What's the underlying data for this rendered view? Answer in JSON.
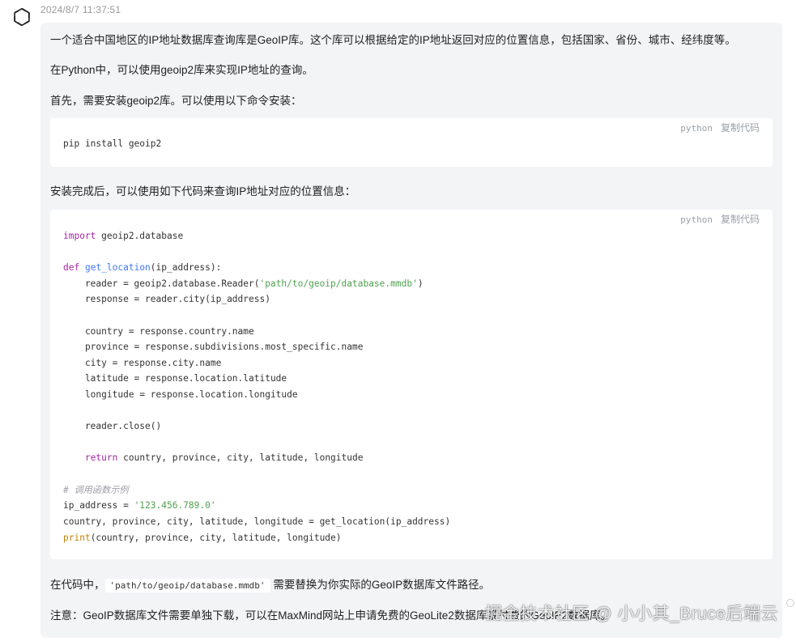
{
  "message": {
    "avatar_icon": "openai-logo-icon",
    "timestamp": "2024/8/7 11:37:51",
    "paragraphs": {
      "p1": "一个适合中国地区的IP地址数据库查询库是GeoIP库。这个库可以根据给定的IP地址返回对应的位置信息，包括国家、省份、城市、经纬度等。",
      "p2": "在Python中，可以使用geoip2库来实现IP地址的查询。",
      "p3": "首先，需要安装geoip2库。可以使用以下命令安装：",
      "p4": "安装完成后，可以使用如下代码来查询IP地址对应的位置信息：",
      "p5_before": "在代码中，",
      "p5_code": "'path/to/geoip/database.mmdb'",
      "p5_after": "需要替换为你实际的GeoIP数据库文件路径。",
      "p6": "注意：GeoIP数据库文件需要单独下载，可以在MaxMind网站上申请免费的GeoLite2数据库或付费的GeoIP2数据库。"
    },
    "code_blocks": {
      "install": {
        "language": "python",
        "copy_label": "复制代码",
        "lines": [
          "pip install geoip2"
        ]
      },
      "main": {
        "language": "python",
        "copy_label": "复制代码",
        "tokens": {
          "import_kw": "import",
          "import_mod": " geoip2.database",
          "def_kw": "def",
          "fn_name": "get_location",
          "def_rest": "(ip_address):",
          "reader_pre": "    reader = geoip2.database.Reader(",
          "reader_str": "'path/to/geoip/database.mmdb'",
          "reader_post": ")",
          "response": "    response = reader.city(ip_address)",
          "country": "    country = response.country.name",
          "province": "    province = response.subdivisions.most_specific.name",
          "city": "    city = response.city.name",
          "latitude": "    latitude = response.location.latitude",
          "longitude": "    longitude = response.location.longitude",
          "close": "    reader.close()",
          "return_kw": "return",
          "return_rest": " country, province, city, latitude, longitude",
          "comment": "# 调用函数示例",
          "ip_pre": "ip_address = ",
          "ip_str": "'123.456.789.0'",
          "call": "country, province, city, latitude, longitude = get_location(ip_address)",
          "print_kw": "print",
          "print_rest": "(country, province, city, latitude, longitude)"
        }
      }
    }
  },
  "watermark": "掘金技术社区 @ 小小其_Bruce后端云"
}
